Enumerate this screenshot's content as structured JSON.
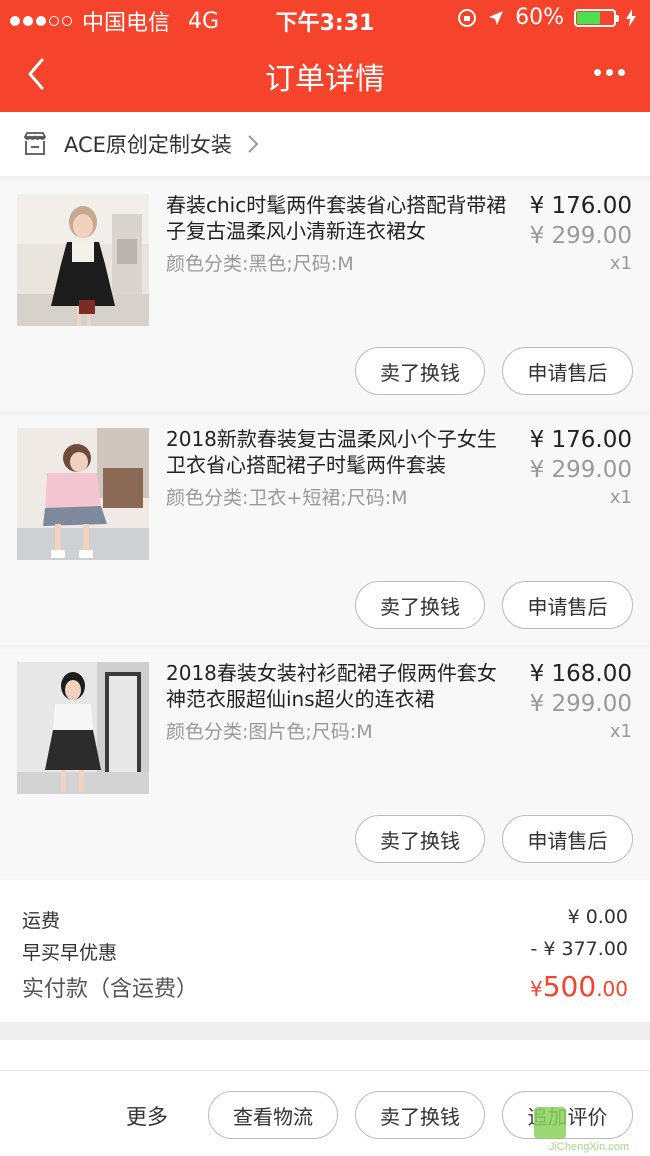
{
  "status_bar": {
    "carrier": "中国电信",
    "network": "4G",
    "time": "下午3:31",
    "battery": "60%"
  },
  "nav": {
    "title": "订单详情"
  },
  "shop": {
    "name": "ACE原创定制女装"
  },
  "items": [
    {
      "name": "春装chic时髦两件套装省心搭配背带裙子复古温柔风小清新连衣裙女",
      "sku": "颜色分类:黑色;尺码:M",
      "price": "¥ 176.00",
      "original_price": "¥ 299.00",
      "quantity": "x1",
      "sell_label": "卖了换钱",
      "after_sale_label": "申请售后"
    },
    {
      "name": "2018新款春装复古温柔风小个子女生卫衣省心搭配裙子时髦两件套装",
      "sku": "颜色分类:卫衣+短裙;尺码:M",
      "price": "¥ 176.00",
      "original_price": "¥ 299.00",
      "quantity": "x1",
      "sell_label": "卖了换钱",
      "after_sale_label": "申请售后"
    },
    {
      "name": "2018春装女装衬衫配裙子假两件套女神范衣服超仙ins超火的连衣裙",
      "sku": "颜色分类:图片色;尺码:M",
      "price": "¥ 168.00",
      "original_price": "¥ 299.00",
      "quantity": "x1",
      "sell_label": "卖了换钱",
      "after_sale_label": "申请售后"
    }
  ],
  "summary": {
    "shipping_label": "运费",
    "shipping_value": "¥ 0.00",
    "discount_label": "早买早优惠",
    "discount_value": "- ¥ 377.00",
    "paid_label": "实付款（含运费）",
    "paid_currency": "¥",
    "paid_int": "500",
    "paid_dec": ".00"
  },
  "bottom_bar": {
    "more_label": "更多",
    "logistics_label": "查看物流",
    "sell_label": "卖了换钱",
    "review_label": "追加评价"
  },
  "watermark": {
    "text": "JiChengXin.com"
  },
  "colors": {
    "accent": "#f5432c",
    "price_highlight": "#f5432c"
  }
}
